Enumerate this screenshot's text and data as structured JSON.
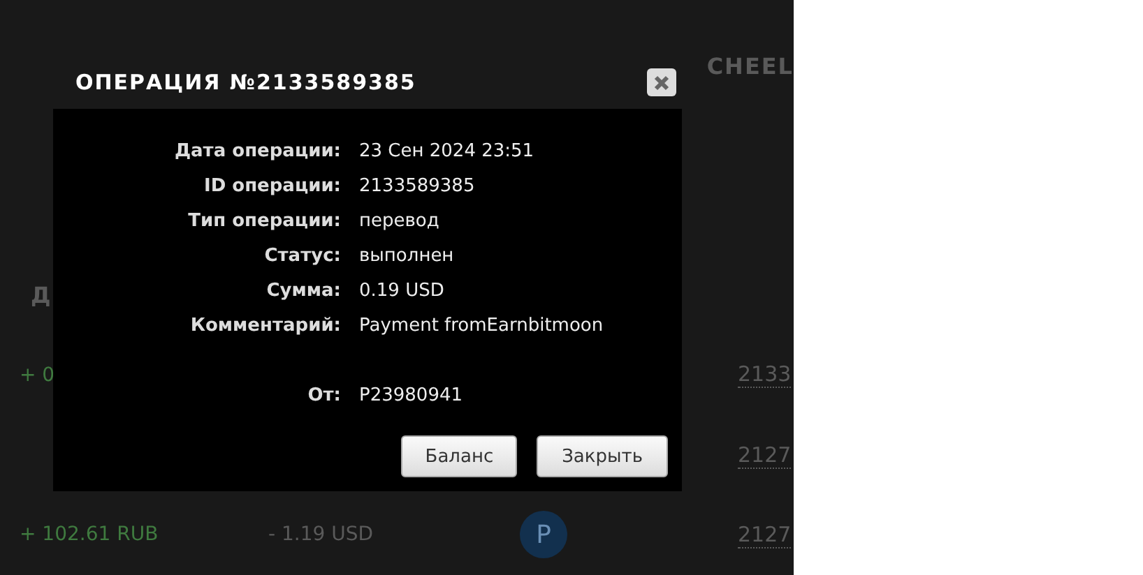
{
  "background": {
    "header_text": "CHEEL",
    "column_heading": "Д",
    "rows": [
      {
        "cells": [
          "+ 0",
          "",
          "",
          "2133"
        ]
      },
      {
        "cells": [
          "",
          "",
          "",
          "2127"
        ]
      },
      {
        "cells": [
          "+ 102.61 RUB",
          "- 1.19 USD",
          "P",
          "2127"
        ]
      }
    ]
  },
  "dialog": {
    "title": "ОПЕРАЦИЯ №2133589385",
    "fields": [
      {
        "label": "Дата операции:",
        "value": "23 Сен 2024 23:51"
      },
      {
        "label": "ID операции:",
        "value": "2133589385"
      },
      {
        "label": "Тип операции:",
        "value": "перевод"
      },
      {
        "label": "Статус:",
        "value": "выполнен"
      },
      {
        "label": "Сумма:",
        "value": "0.19 USD"
      },
      {
        "label": "Комментарий:",
        "value": "Payment fromEarnbitmoon"
      },
      {
        "label": "От:",
        "value": "P23980941",
        "gap": true
      }
    ],
    "buttons": [
      "Баланс",
      "Закрыть"
    ]
  }
}
